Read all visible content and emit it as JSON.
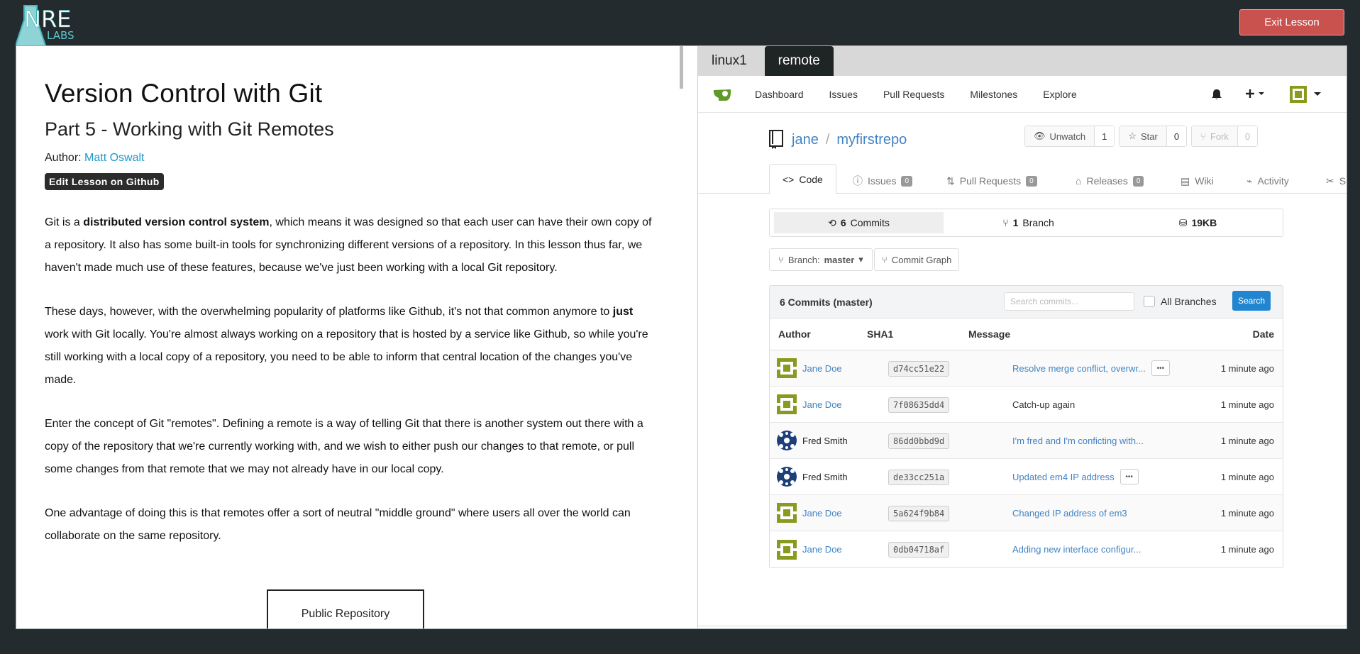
{
  "header": {
    "logo_main": "NRE",
    "logo_sub": "LABS",
    "exit_label": "Exit Lesson",
    "exit_color": "#c9524f"
  },
  "lesson": {
    "title": "Version Control with Git",
    "subtitle": "Part 5 - Working with Git Remotes",
    "author_prefix": "Author: ",
    "author_name": "Matt Oswalt",
    "edit_badge": "Edit Lesson on Github",
    "p1_a": "Git is a ",
    "p1_bold": "distributed version control system",
    "p1_b": ", which means it was designed so that each user can have their own copy of a repository. It also has some built-in tools for synchronizing different versions of a repository. In this lesson thus far, we haven't made much use of these features, because we've just been working with a local Git repository.",
    "p2_a": "These days, however, with the overwhelming popularity of platforms like Github, it's not that common anymore to ",
    "p2_bold": "just",
    "p2_b": " work with Git locally. You're almost always working on a repository that is hosted by a service like Github, so while you're still working with a local copy of a repository, you need to be able to inform that central location of the changes you've made.",
    "p3": "Enter the concept of Git \"remotes\". Defining a remote is a way of telling Git that there is another system out there with a copy of the repository that we're currently working with, and we wish to either push our changes to that remote, or pull some changes from that remote that we may not already have in our local copy.",
    "p4": "One advantage of doing this is that remotes offer a sort of neutral \"middle ground\" where users all over the world can collaborate on the same repository.",
    "diagram_label": "Public Repository"
  },
  "terminal": {
    "tabs": [
      "linux1",
      "remote"
    ],
    "active_tab": "remote"
  },
  "gitea": {
    "nav": [
      "Dashboard",
      "Issues",
      "Pull Requests",
      "Milestones",
      "Explore"
    ],
    "owner": "jane",
    "repo": "myfirstrepo",
    "watch_label": "Unwatch",
    "watch_count": "1",
    "star_label": "Star",
    "star_count": "0",
    "fork_label": "Fork",
    "fork_count": "0",
    "tabs": {
      "code": "Code",
      "issues": "Issues",
      "issues_count": "0",
      "pulls": "Pull Requests",
      "pulls_count": "0",
      "releases": "Releases",
      "releases_count": "0",
      "wiki": "Wiki",
      "activity": "Activity",
      "settings": "Set"
    },
    "stats": {
      "commits_num": "6",
      "commits_label": "Commits",
      "branch_num": "1",
      "branch_label": "Branch",
      "size": "19KB"
    },
    "branch_prefix": "Branch: ",
    "branch_name": "master",
    "commit_graph": "Commit Graph",
    "table": {
      "title": "6 Commits (master)",
      "search_placeholder": "Search commits...",
      "all_branches": "All Branches",
      "search_btn": "Search",
      "col_author": "Author",
      "col_sha": "SHA1",
      "col_message": "Message",
      "col_date": "Date",
      "rows": [
        {
          "author": "Jane Doe",
          "sha": "d74cc51e22",
          "message": "Resolve merge conflict, overwr...",
          "date": "1 minute ago"
        },
        {
          "author": "Jane Doe",
          "sha": "7f08635dd4",
          "message": "Catch-up again",
          "date": "1 minute ago"
        },
        {
          "author": "Fred Smith",
          "sha": "86dd0bbd9d",
          "message": "I'm fred and I'm conficting with...",
          "date": "1 minute ago"
        },
        {
          "author": "Fred Smith",
          "sha": "de33cc251a",
          "message": "Updated em4 IP address",
          "date": "1 minute ago"
        },
        {
          "author": "Jane Doe",
          "sha": "5a624f9b84",
          "message": "Changed IP address of em3",
          "date": "1 minute ago"
        },
        {
          "author": "Jane Doe",
          "sha": "0db04718af",
          "message": "Adding new interface configur...",
          "date": "1 minute ago"
        }
      ]
    },
    "accent": "#2185d0",
    "link_color": "#4183c4",
    "logo_color": "#609926"
  }
}
